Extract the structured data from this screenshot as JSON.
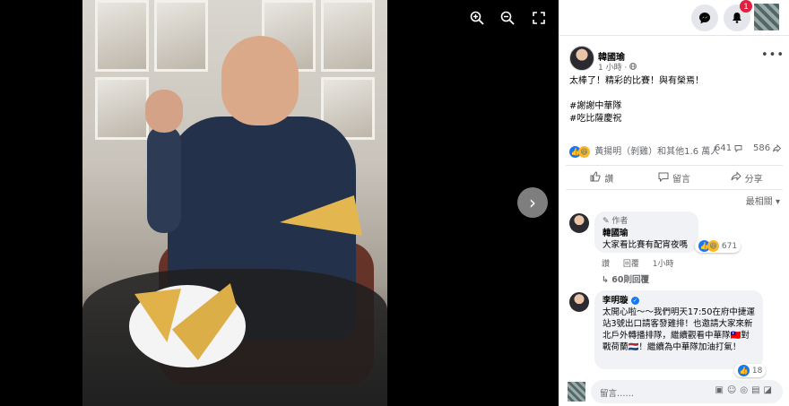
{
  "viewer": {
    "zoom_in_icon": "zoom-in-icon",
    "zoom_out_icon": "zoom-out-icon",
    "fullscreen_icon": "fullscreen-icon",
    "next_icon": "chevron-right-icon"
  },
  "topbar": {
    "notifications_count": "1"
  },
  "post": {
    "author": "韓國瑜",
    "time": "1 小時",
    "privacy_icon": "globe-icon",
    "text_line1": "太棒了！精彩的比賽！與有榮焉！",
    "hashtag1": "#謝謝中華隊",
    "hashtag2": "#吃比薩慶祝",
    "reactions_text": "黃揚明（剝雞）和其他1.6 萬人",
    "comments_count": "641",
    "shares_count": "586",
    "like_label": "讚",
    "comment_label": "留言",
    "share_label": "分享"
  },
  "sort_label": "最相關",
  "comments": [
    {
      "tag": "作者",
      "name": "韓國瑜",
      "text": "大家看比賽有配宵夜嗎",
      "like_label": "讚",
      "reply_label": "回覆",
      "time": "1小時",
      "reactions": "671",
      "replies": "60則回覆"
    },
    {
      "name": "李明璇",
      "text": "太開心啦～～我們明天17:50在府中捷運站3號出口請客發雞排！也邀請大家來新北戶外轉播排隊，繼續觀看中華隊🇹🇼對戰荷蘭🇳🇱！繼續為中華隊加油打氣！",
      "reactions": "18"
    }
  ],
  "composer": {
    "placeholder": "留言……"
  },
  "colors": {
    "accent": "#1877f2",
    "badge": "#e41e3f"
  }
}
